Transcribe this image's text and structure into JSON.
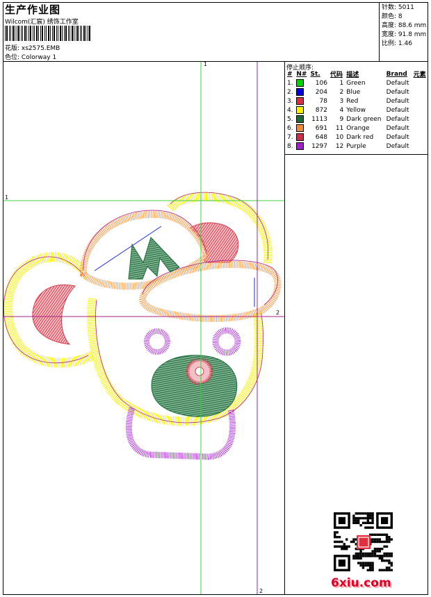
{
  "header": {
    "title": "生产作业图",
    "studio": "Wilcom(汇宸) 绣饰工作室",
    "design_label": "花版:",
    "design_value": "xs2575.EMB",
    "colorway_label": "色位:",
    "colorway_value": "Colorway 1"
  },
  "stats": {
    "stitches": "针数: 5011",
    "colors": "颜色: 8",
    "height": "高度: 88.6 mm",
    "width": "宽度: 91.8 mm",
    "scale": "比例: 1.46"
  },
  "sequence": {
    "title": "停止顺序:",
    "headers": [
      "#",
      "N#",
      "St.",
      "代码",
      "描述",
      "Brand",
      "元素"
    ],
    "rows": [
      {
        "idx": "1.",
        "n": "1",
        "st": "106",
        "code": "1",
        "desc": "Green",
        "brand": "Default",
        "color": "#00d000"
      },
      {
        "idx": "2.",
        "n": "2",
        "st": "204",
        "code": "2",
        "desc": "Blue",
        "brand": "Default",
        "color": "#0000e0"
      },
      {
        "idx": "3.",
        "n": "3",
        "st": "78",
        "code": "3",
        "desc": "Red",
        "brand": "Default",
        "color": "#d83040"
      },
      {
        "idx": "4.",
        "n": "4",
        "st": "872",
        "code": "4",
        "desc": "Yellow",
        "brand": "Default",
        "color": "#f8f000"
      },
      {
        "idx": "5.",
        "n": "9",
        "st": "1113",
        "code": "9",
        "desc": "Dark green",
        "brand": "Default",
        "color": "#1a6a3a"
      },
      {
        "idx": "6.",
        "n": "11",
        "st": "691",
        "code": "11",
        "desc": "Orange",
        "brand": "Default",
        "color": "#f08c40"
      },
      {
        "idx": "7.",
        "n": "10",
        "st": "648",
        "code": "10",
        "desc": "Dark red",
        "brand": "Default",
        "color": "#c83048"
      },
      {
        "idx": "8.",
        "n": "12",
        "st": "1297",
        "code": "12",
        "desc": "Purple",
        "brand": "Default",
        "color": "#a020c8"
      }
    ]
  },
  "guides": {
    "v1": "1",
    "h1": "1",
    "h2": "2",
    "v2": "2"
  },
  "design_colors": {
    "yellow": "#f4ef00",
    "orange": "#f29a4a",
    "red": "#d63a4a",
    "dark_green": "#1d6b3c",
    "purple": "#a41fd0",
    "magenta_outline": "#b0208a",
    "green_guide": "#3ad03a",
    "blue": "#1a2ad8"
  },
  "watermark": "6xiu.com"
}
